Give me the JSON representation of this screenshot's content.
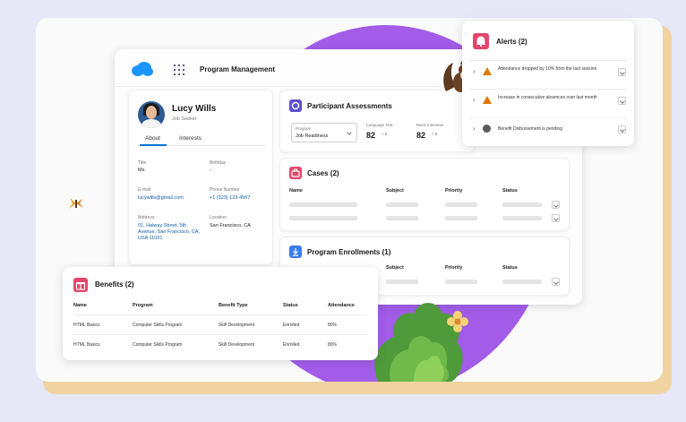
{
  "app": {
    "title": "Program Management"
  },
  "profile": {
    "name": "Lucy Wills",
    "role": "Job Seeker",
    "tabs": [
      "About",
      "Interests"
    ],
    "fields": {
      "title_label": "Title",
      "title_value": "Ms.",
      "birthday_label": "Birthday",
      "birthday_value": "-",
      "email_label": "E-mail",
      "email_value": "lucywills@gmail.com",
      "phone_label": "Phone Number",
      "phone_value": "+1 (323) 123-4567",
      "address_label": "Address",
      "address_value": "01, Halway Street, 5th Avenue, San Francisco, CA, USA 11031",
      "location_label": "Location",
      "location_value": "San Francisco, CA"
    }
  },
  "assessments": {
    "title": "Participant Assessments",
    "program_label": "Program",
    "program_value": "Job Readiness",
    "metrics": [
      {
        "label": "Language Test",
        "value": "82",
        "unit": "+ 8"
      },
      {
        "label": "Mock Interview",
        "value": "82",
        "unit": "+ 8"
      }
    ]
  },
  "cases": {
    "title": "Cases (2)",
    "columns": [
      "Name",
      "Subject",
      "Priority",
      "Status"
    ]
  },
  "enrollments": {
    "title": "Program Enrollments (1)",
    "columns": [
      "Subject",
      "Priority",
      "Status"
    ]
  },
  "alerts": {
    "title": "Alerts (2)",
    "items": [
      {
        "text": "Attendance dropped by 10% from the last session"
      },
      {
        "text": "Increase in consecutive absences over last month"
      },
      {
        "text": "Benefit Disbursement is pending"
      }
    ]
  },
  "benefits": {
    "title": "Benefits (2)",
    "columns": [
      "Name",
      "Program",
      "Benefit Type",
      "Status",
      "Attendance"
    ],
    "rows": [
      [
        "HTML Basics",
        "Computer Skills Program",
        "Skill Development",
        "Enrolled",
        "80%"
      ],
      [
        "HTML Basics",
        "Computer Skills Program",
        "Skill Development",
        "Enrolled",
        "80%"
      ]
    ]
  },
  "colors": {
    "background": "#e6e7f7",
    "blob": "#a25ce8",
    "frame_shadow": "#f1d3a2",
    "brand_blue": "#1b96ff",
    "cases_icon": "#e3466b",
    "alerts_icon": "#e3466b",
    "benefits_icon": "#e3466b",
    "assess_icon": "#5a4fcf",
    "enroll_icon": "#3b7ded",
    "warning": "#dd7a01"
  },
  "icons": [
    "cloud-logo-icon",
    "app-launcher-icon",
    "bell-icon",
    "warning-icon",
    "info-icon",
    "gift-icon",
    "briefcase-icon",
    "assessment-icon",
    "enrollment-icon",
    "chevron-right-icon",
    "dropdown-icon"
  ]
}
